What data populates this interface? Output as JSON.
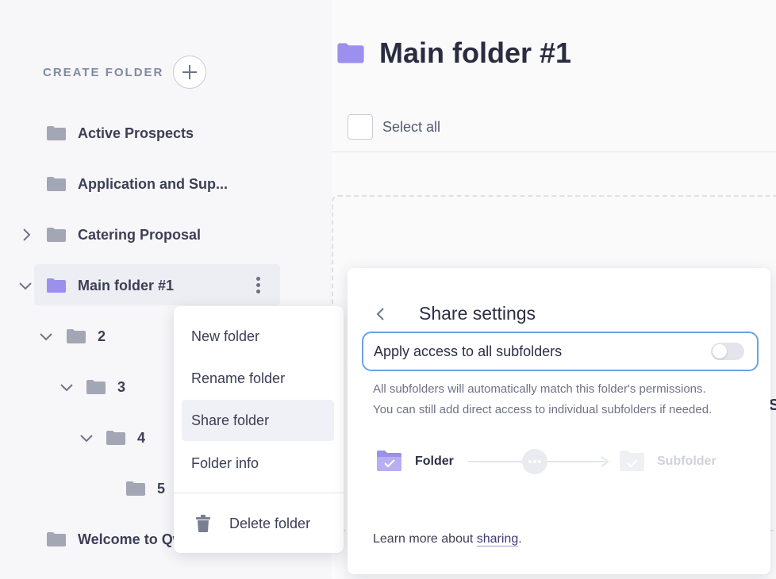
{
  "sidebar": {
    "create_label": "CREATE FOLDER",
    "items": [
      {
        "label": "Active Prospects"
      },
      {
        "label": "Application and Sup..."
      },
      {
        "label": "Catering Proposal"
      },
      {
        "label": "Main folder #1"
      },
      {
        "label": "2"
      },
      {
        "label": "3"
      },
      {
        "label": "4"
      },
      {
        "label": "5"
      },
      {
        "label": "Welcome to Qw"
      }
    ]
  },
  "main": {
    "title": "Main folder #1",
    "select_all": "Select all",
    "peek_text": "S"
  },
  "context_menu": {
    "items": [
      {
        "label": "New folder"
      },
      {
        "label": "Rename folder"
      },
      {
        "label": "Share folder"
      },
      {
        "label": "Folder info"
      }
    ],
    "delete_label": "Delete folder"
  },
  "share": {
    "title": "Share settings",
    "apply_label": "Apply access to all subfolders",
    "apply_enabled": false,
    "desc_line1": "All subfolders will automatically match this folder's permissions.",
    "desc_line2": "You can still add direct access to individual subfolders if needed.",
    "diagram_folder": "Folder",
    "diagram_subfolder": "Subfolder",
    "learn_prefix": "Learn more about ",
    "learn_link": "sharing",
    "learn_suffix": "."
  },
  "colors": {
    "accent_purple": "#9b90ee",
    "folder_gray": "#a3a6b4",
    "focus_blue": "#6ba3e0"
  }
}
